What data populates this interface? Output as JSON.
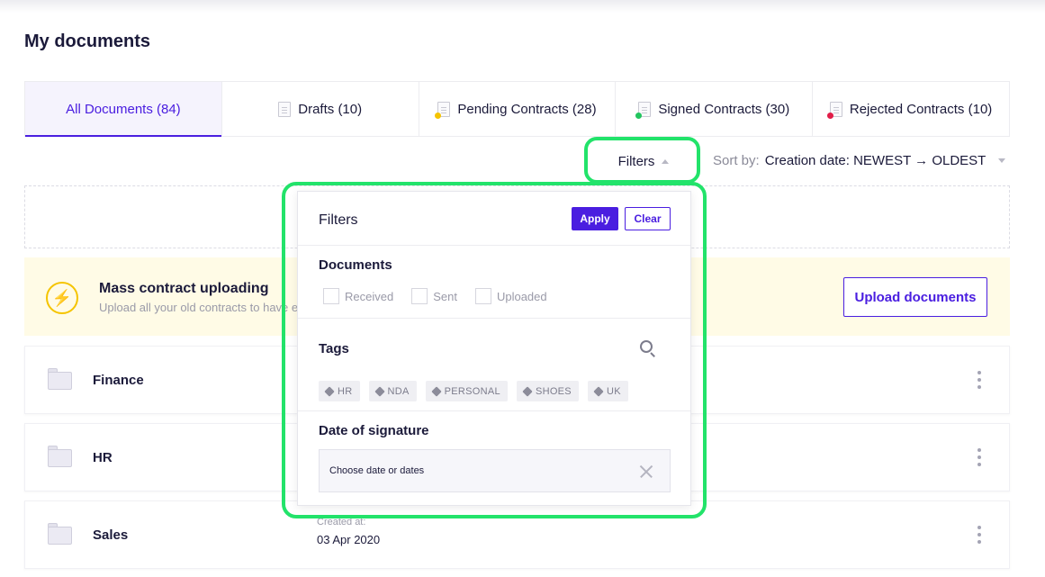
{
  "page": {
    "title": "My documents"
  },
  "tabs": [
    {
      "label": "All Documents (84)",
      "active": true
    },
    {
      "label": "Drafts (10)",
      "status_color": ""
    },
    {
      "label": "Pending Contracts (28)",
      "status_color": "#f5c400"
    },
    {
      "label": "Signed Contracts (30)",
      "status_color": "#22c55e"
    },
    {
      "label": "Rejected Contracts (10)",
      "status_color": "#e11d48"
    }
  ],
  "toolbar": {
    "filters_label": "Filters",
    "sort_label": "Sort by:",
    "sort_value": "Creation date: NEWEST → OLDEST"
  },
  "banner": {
    "title": "Mass contract uploading",
    "subtitle": "Upload all your old contracts to have e",
    "button": "Upload documents",
    "icon": "lightning-icon"
  },
  "folders": [
    {
      "name": "Finance"
    },
    {
      "name": "HR"
    },
    {
      "name": "Sales",
      "created_label": "Created at:",
      "created_value": "03 Apr 2020"
    }
  ],
  "filters_panel": {
    "title": "Filters",
    "apply": "Apply",
    "clear": "Clear",
    "documents_title": "Documents",
    "document_options": [
      "Received",
      "Sent",
      "Uploaded"
    ],
    "tags_title": "Tags",
    "tags": [
      "HR",
      "NDA",
      "PERSONAL",
      "SHOES",
      "UK"
    ],
    "date_title": "Date of signature",
    "date_placeholder": "Choose date or dates"
  },
  "colors": {
    "accent": "#4a1ee0",
    "highlight": "#22e36a",
    "banner_bg": "#fffbe6"
  }
}
